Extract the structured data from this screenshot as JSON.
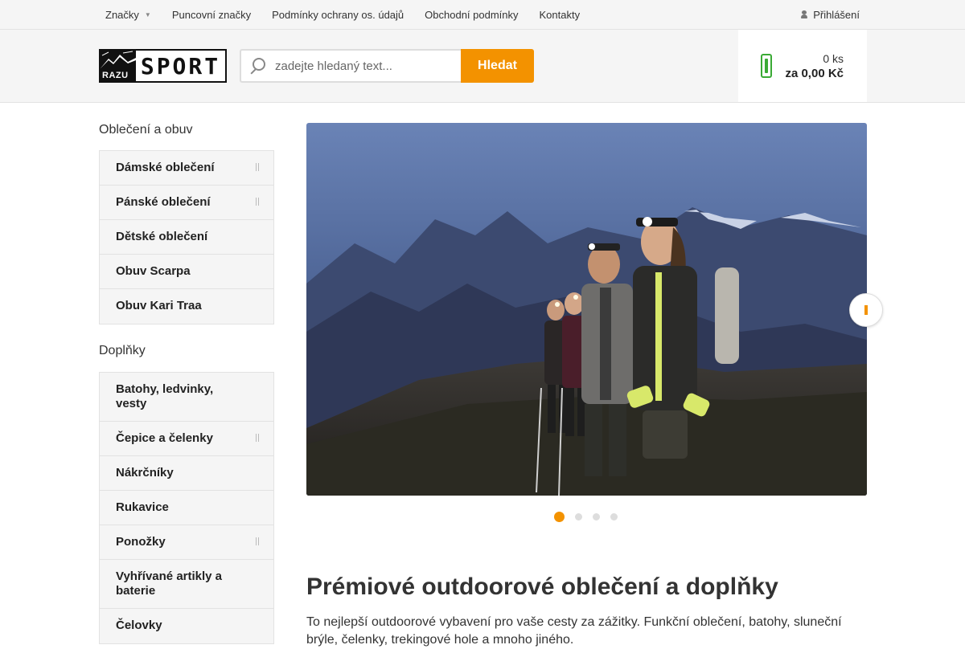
{
  "topnav": {
    "items": [
      {
        "label": "Značky",
        "has_dropdown": true
      },
      {
        "label": "Puncovní značky"
      },
      {
        "label": "Podmínky ochrany os. údajů"
      },
      {
        "label": "Obchodní podmínky"
      },
      {
        "label": "Kontakty"
      }
    ],
    "login_label": "Přihlášení"
  },
  "header": {
    "logo_small": "RAZU",
    "logo_big": "SPORT",
    "search_placeholder": "zadejte hledaný text...",
    "search_button": "Hledat",
    "cart": {
      "qty": "0 ks",
      "total": "za 0,00 Kč"
    }
  },
  "sidebar": {
    "sections": [
      {
        "title": "Oblečení a obuv",
        "items": [
          {
            "label": "Dámské oblečení",
            "has_sub": true
          },
          {
            "label": "Pánské oblečení",
            "has_sub": true
          },
          {
            "label": "Dětské oblečení",
            "has_sub": false
          },
          {
            "label": "Obuv Scarpa",
            "has_sub": false
          },
          {
            "label": "Obuv Kari Traa",
            "has_sub": false
          }
        ]
      },
      {
        "title": "Doplňky",
        "items": [
          {
            "label": "Batohy, ledvinky, vesty",
            "has_sub": false
          },
          {
            "label": "Čepice a čelenky",
            "has_sub": true
          },
          {
            "label": "Nákrčníky",
            "has_sub": false
          },
          {
            "label": "Rukavice",
            "has_sub": false
          },
          {
            "label": "Ponožky",
            "has_sub": true
          },
          {
            "label": "Vyhřívané artikly a baterie",
            "has_sub": false
          },
          {
            "label": "Čelovky",
            "has_sub": false
          }
        ]
      }
    ]
  },
  "banner": {
    "slide_count": 4,
    "active_slide": 1
  },
  "content": {
    "heading": "Prémiové outdoorové oblečení a doplňky",
    "text": "To nejlepší outdoorové vybavení pro vaše cesty za zážitky. Funkční oblečení, batohy, sluneční brýle, čelenky, trekingové hole a mnoho jiného."
  },
  "colors": {
    "accent": "#f39200",
    "cart_icon": "#3aaa35"
  }
}
